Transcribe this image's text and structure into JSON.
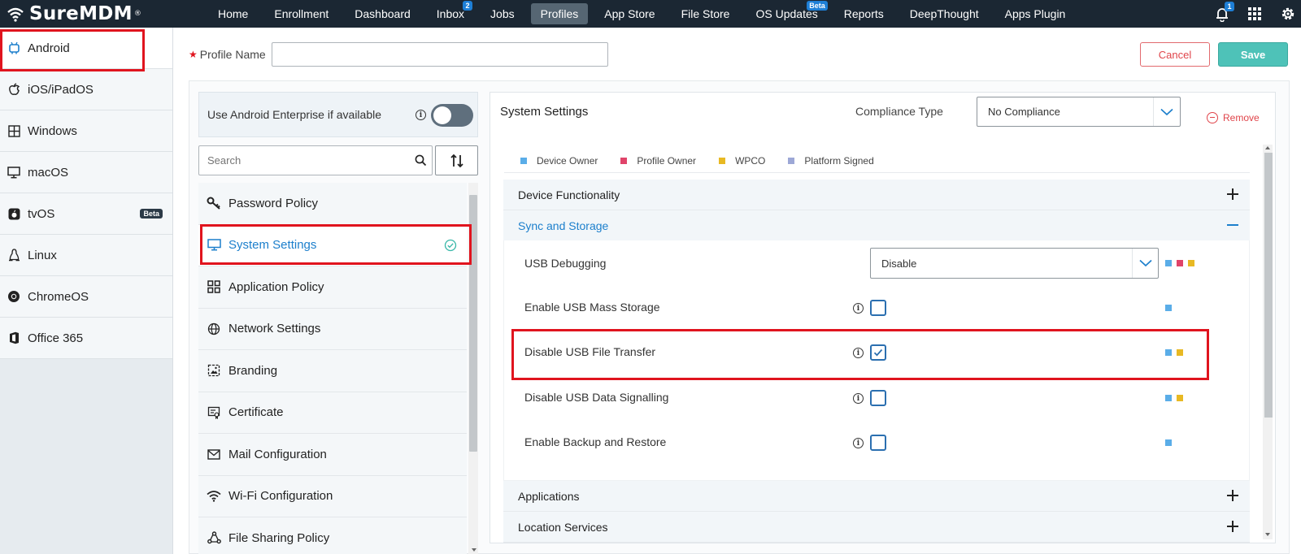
{
  "app": {
    "logo_text": "SureMDM",
    "logo_mark": "®"
  },
  "nav": {
    "items": [
      {
        "label": "Home"
      },
      {
        "label": "Enrollment"
      },
      {
        "label": "Dashboard"
      },
      {
        "label": "Inbox",
        "badge": "2"
      },
      {
        "label": "Jobs"
      },
      {
        "label": "Profiles",
        "active": true
      },
      {
        "label": "App Store"
      },
      {
        "label": "File Store"
      },
      {
        "label": "OS Updates",
        "badge": "Beta"
      },
      {
        "label": "Reports"
      },
      {
        "label": "DeepThought"
      },
      {
        "label": "Apps Plugin"
      }
    ],
    "notifications_badge": "1",
    "icons": [
      "bell-icon",
      "apps-grid-icon",
      "gear-icon"
    ]
  },
  "os_list": [
    {
      "label": "Android",
      "icon": "android-icon",
      "active": true
    },
    {
      "label": "iOS/iPadOS",
      "icon": "apple-icon"
    },
    {
      "label": "Windows",
      "icon": "windows-icon"
    },
    {
      "label": "macOS",
      "icon": "monitor-icon"
    },
    {
      "label": "tvOS",
      "icon": "tv-icon",
      "badge": "Beta"
    },
    {
      "label": "Linux",
      "icon": "linux-icon"
    },
    {
      "label": "ChromeOS",
      "icon": "chrome-icon"
    },
    {
      "label": "Office 365",
      "icon": "office-icon"
    }
  ],
  "profile": {
    "name_label": "Profile Name",
    "name_value": "",
    "cancel_label": "Cancel",
    "save_label": "Save"
  },
  "android_enterprise": {
    "label": "Use Android Enterprise if available",
    "enabled": false
  },
  "search": {
    "placeholder": "Search"
  },
  "policies": [
    {
      "label": "Password Policy",
      "icon": "key-icon"
    },
    {
      "label": "System Settings",
      "icon": "monitor-icon",
      "active": true,
      "configured": true
    },
    {
      "label": "Application Policy",
      "icon": "app-grid-icon"
    },
    {
      "label": "Network Settings",
      "icon": "globe-icon"
    },
    {
      "label": "Branding",
      "icon": "image-icon"
    },
    {
      "label": "Certificate",
      "icon": "certificate-icon"
    },
    {
      "label": "Mail Configuration",
      "icon": "mail-icon"
    },
    {
      "label": "Wi-Fi Configuration",
      "icon": "wifi-icon"
    },
    {
      "label": "File Sharing Policy",
      "icon": "share-icon"
    }
  ],
  "system_settings": {
    "title": "System Settings",
    "compliance_label": "Compliance Type",
    "compliance_value": "No Compliance",
    "remove_label": "Remove",
    "legend": [
      {
        "label": "Device Owner",
        "color": "#5aade8"
      },
      {
        "label": "Profile Owner",
        "color": "#e0446a"
      },
      {
        "label": "WPCO",
        "color": "#e8b923"
      },
      {
        "label": "Platform Signed",
        "color": "#9da8d6"
      }
    ],
    "sections": [
      {
        "label": "Device Functionality",
        "open": false
      },
      {
        "label": "Sync and Storage",
        "open": true
      },
      {
        "label": "Applications",
        "open": false
      },
      {
        "label": "Location Services",
        "open": false
      }
    ],
    "settings": [
      {
        "label": "USB Debugging",
        "type": "select",
        "value": "Disable",
        "tags": [
          "#5aade8",
          "#e0446a",
          "#e8b923"
        ]
      },
      {
        "label": "Enable USB Mass Storage",
        "type": "checkbox",
        "checked": false,
        "tags": [
          "#5aade8"
        ]
      },
      {
        "label": "Disable USB File Transfer",
        "type": "checkbox",
        "checked": true,
        "tags": [
          "#5aade8",
          "#e8b923"
        ]
      },
      {
        "label": "Disable USB Data Signalling",
        "type": "checkbox",
        "checked": false,
        "tags": [
          "#5aade8",
          "#e8b923"
        ]
      },
      {
        "label": "Enable Backup and Restore",
        "type": "checkbox",
        "checked": false,
        "tags": [
          "#5aade8"
        ]
      }
    ]
  }
}
